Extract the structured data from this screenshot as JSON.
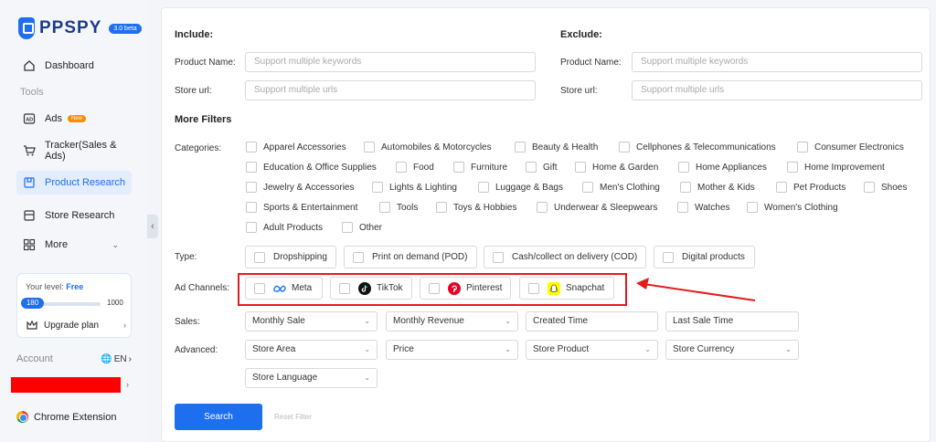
{
  "brand": {
    "name": "PPSPY",
    "badge": "3.0 beta"
  },
  "sidebar": {
    "dashboard": "Dashboard",
    "tools_label": "Tools",
    "items": [
      {
        "label": "Ads",
        "badge": "New"
      },
      {
        "label": "Tracker(Sales & Ads)"
      },
      {
        "label": "Product Research"
      },
      {
        "label": "Store Research"
      },
      {
        "label": "More"
      }
    ],
    "level": {
      "prefix": "Your level:",
      "value": "Free",
      "current": "180",
      "max": "1000",
      "progress_fraction": 0.18
    },
    "upgrade": "Upgrade plan",
    "account": "Account",
    "language": "EN",
    "chrome_extension": "Chrome Extension"
  },
  "filters": {
    "include_title": "Include:",
    "exclude_title": "Exclude:",
    "product_name_label": "Product Name:",
    "store_url_label": "Store url:",
    "keywords_placeholder": "Support multiple keywords",
    "urls_placeholder": "Support multiple urls",
    "more_filters": "More Filters",
    "categories_label": "Categories:",
    "categories": [
      "Apparel Accessories",
      "Automobiles & Motorcycles",
      "Beauty & Health",
      "Cellphones & Telecommunications",
      "Consumer Electronics",
      "Education & Office Supplies",
      "Food",
      "Furniture",
      "Gift",
      "Home & Garden",
      "Home Appliances",
      "Home Improvement",
      "Jewelry & Accessories",
      "Lights & Lighting",
      "Luggage & Bags",
      "Men's Clothing",
      "Mother & Kids",
      "Pet Products",
      "Shoes",
      "Sports & Entertainment",
      "Tools",
      "Toys & Hobbies",
      "Underwear & Sleepwears",
      "Watches",
      "Women's Clothing",
      "Adult Products",
      "Other"
    ],
    "type_label": "Type:",
    "types": [
      "Dropshipping",
      "Print on demand (POD)",
      "Cash/collect on delivery (COD)",
      "Digital products"
    ],
    "ad_channels_label": "Ad Channels:",
    "ad_channels": [
      "Meta",
      "TikTok",
      "Pinterest",
      "Snapchat"
    ],
    "sales_label": "Sales:",
    "sales": [
      "Monthly Sale",
      "Monthly Revenue",
      "Created Time",
      "Last Sale Time"
    ],
    "advanced_label": "Advanced:",
    "advanced": [
      "Store Area",
      "Price",
      "Store Product",
      "Store Currency",
      "Store Language"
    ],
    "search": "Search",
    "reset": "Reset Filter"
  },
  "colors": {
    "accent": "#1e6ef0",
    "annotation": "#e21d1d",
    "redaction": "#ff0000"
  }
}
